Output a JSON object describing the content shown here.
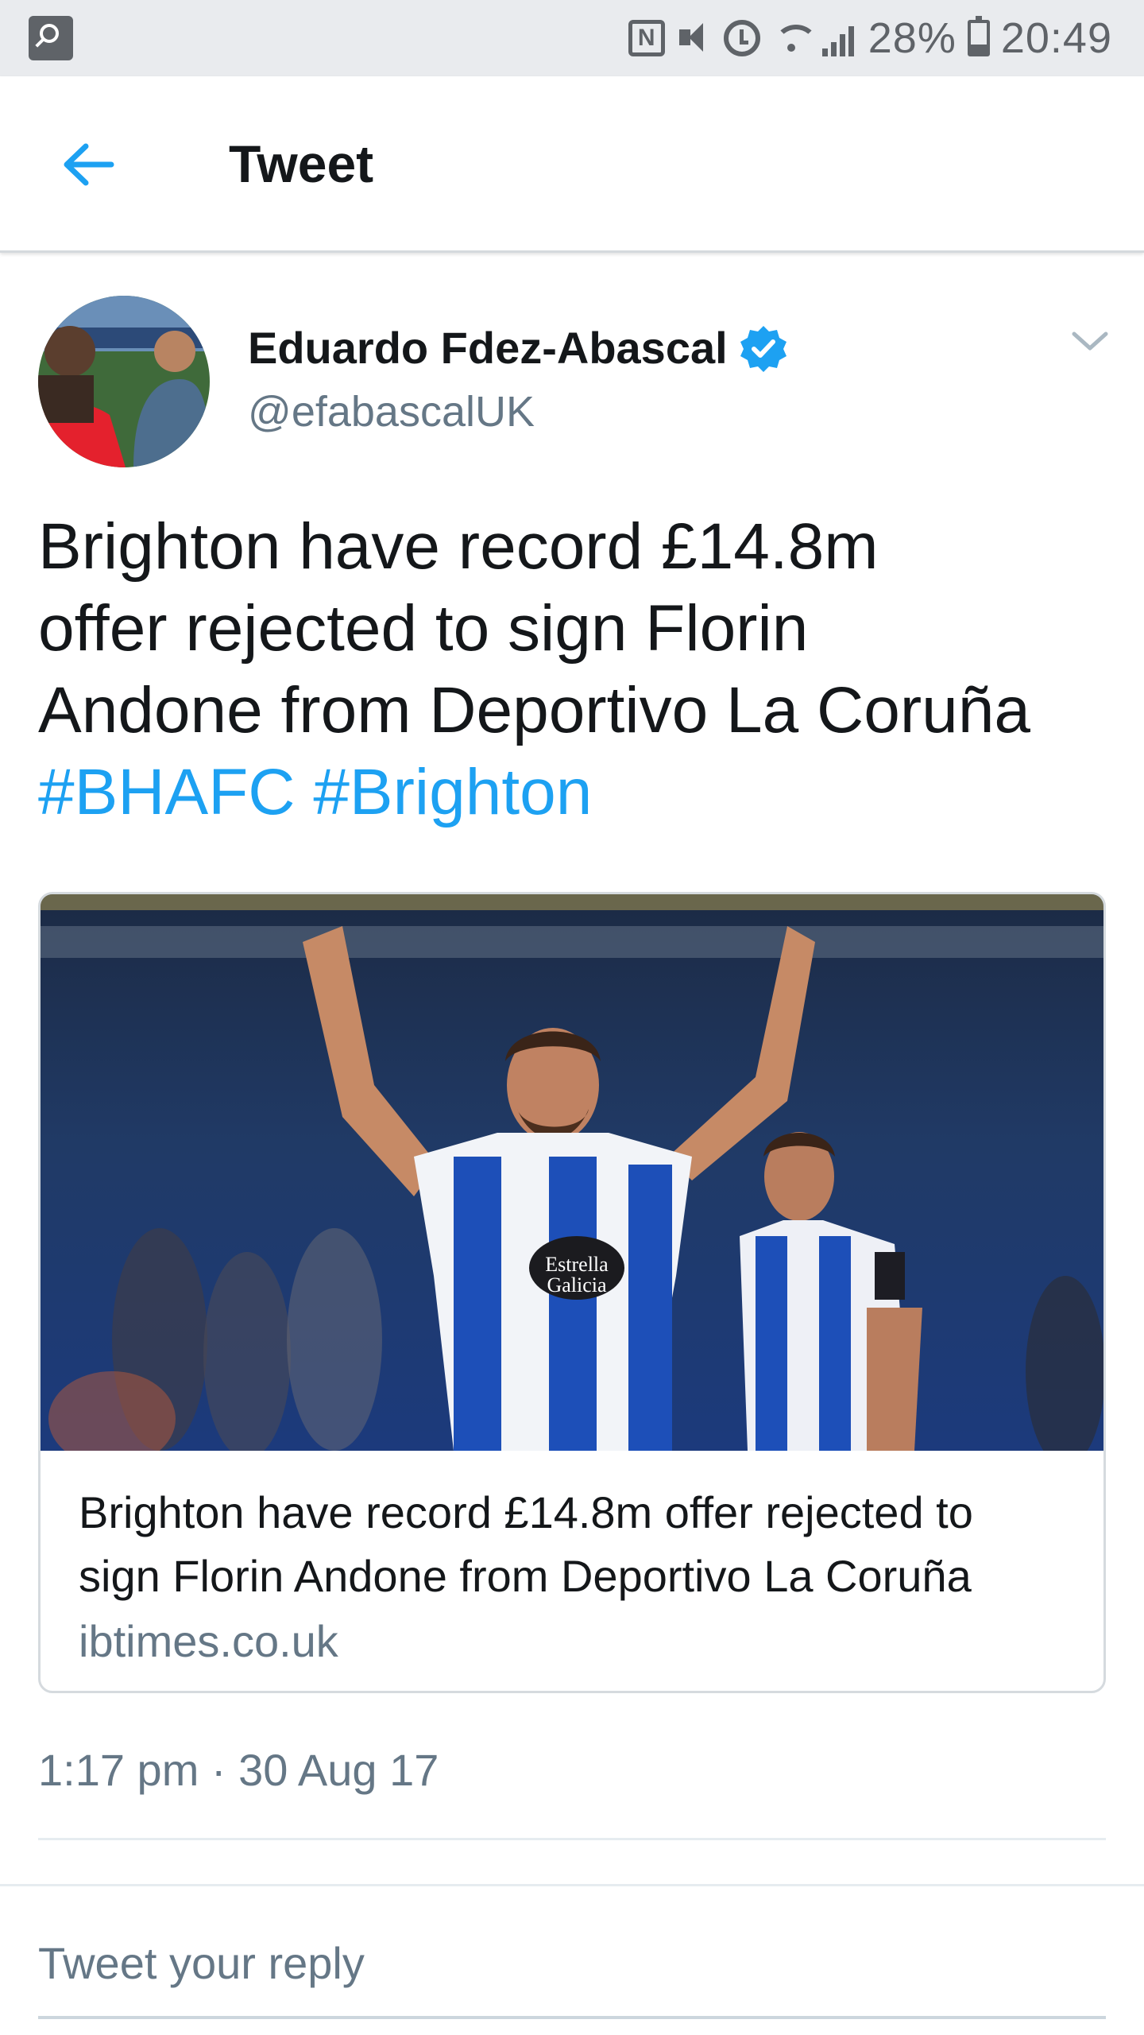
{
  "status_bar": {
    "battery": "28%",
    "time": "20:49",
    "battery_level": 0.28
  },
  "app_bar": {
    "title": "Tweet",
    "back_icon": "arrow-left-icon"
  },
  "tweet": {
    "author_name": "Eduardo Fdez-Abascal",
    "author_handle": "@efabascalUK",
    "verified": true,
    "text_lines": [
      "Brighton have record £14.8m",
      "offer rejected to sign Florin",
      "Andone from Deportivo La Coruña"
    ],
    "hashtags": [
      "#BHAFC",
      "#Brighton"
    ],
    "timestamp": "1:17 pm · 30 Aug 17"
  },
  "card": {
    "title_lines": [
      "Brighton have record £14.8m offer rejected to",
      "sign Florin Andone from Deportivo La Coruña"
    ],
    "domain": "ibtimes.co.uk",
    "image_icon": "footballers-celebrating-image"
  },
  "reply": {
    "placeholder": "Tweet your reply"
  },
  "colors": {
    "accent": "#1da1f2",
    "text": "#14171a",
    "secondary": "#657786"
  }
}
